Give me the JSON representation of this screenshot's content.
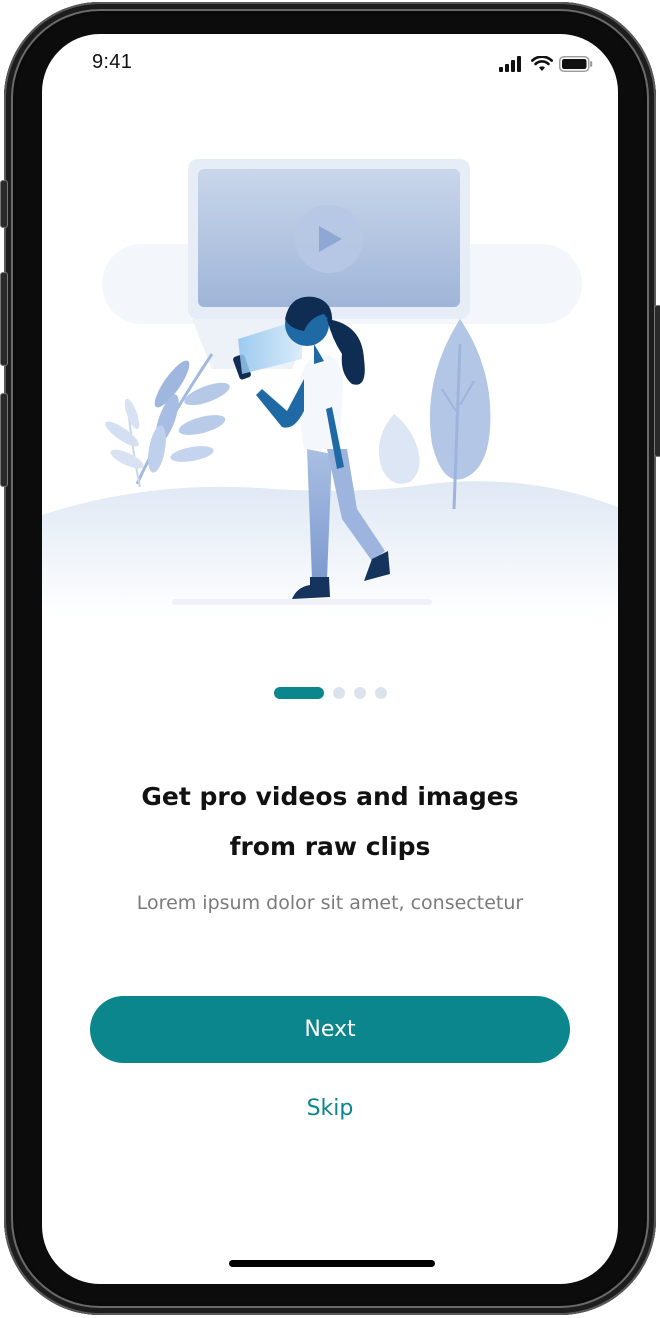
{
  "status_bar": {
    "time": "9:41",
    "icons": [
      "signal-icon",
      "wifi-icon",
      "battery-icon"
    ]
  },
  "illustration": {
    "name": "woman-watching-video-on-phone",
    "icon": "play-icon"
  },
  "pagination": {
    "total": 4,
    "current": 1
  },
  "onboarding": {
    "title_line1": "Get pro videos and images",
    "title_line2": "from raw clips",
    "subtitle": "Lorem ipsum dolor sit amet, consectetur"
  },
  "actions": {
    "next_label": "Next",
    "skip_label": "Skip"
  },
  "colors": {
    "accent": "#0b868c",
    "title_text": "#111111",
    "subtitle_text": "#7b7b7b",
    "dot_inactive": "#dce3ed"
  }
}
